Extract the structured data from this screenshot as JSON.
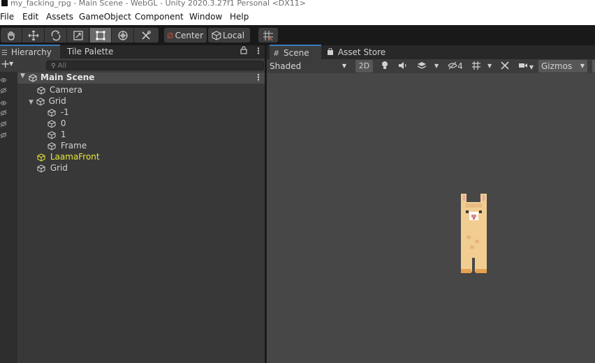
{
  "window": {
    "title": "my_facking_rpg - Main Scene - WebGL - Unity 2020.3.27f1 Personal <DX11>"
  },
  "menu": [
    "File",
    "Edit",
    "Assets",
    "GameObject",
    "Component",
    "Window",
    "Help"
  ],
  "toolbar": {
    "tools": [
      "hand-tool",
      "move-tool",
      "rotate-tool",
      "scale-tool",
      "rect-tool",
      "transform-tool",
      "custom-tool"
    ],
    "active_tool": "rect-tool",
    "pivot_label": "Center",
    "space_label": "Local"
  },
  "hierarchy": {
    "tab_label": "Hierarchy",
    "second_tab_label": "Tile Palette",
    "search_placeholder": "All",
    "scene_name": "Main Scene",
    "items": [
      {
        "label": "Camera"
      },
      {
        "label": "Grid"
      },
      {
        "label": "-1"
      },
      {
        "label": "0"
      },
      {
        "label": "1"
      },
      {
        "label": "Frame"
      },
      {
        "label": "LaamaFront",
        "highlight_color": "#e8e83a"
      },
      {
        "label": "Grid"
      }
    ]
  },
  "scene": {
    "tab_label": "Scene",
    "second_tab_label": "Asset Store",
    "shading_mode": "Shaded",
    "mode_2d_label": "2D",
    "hidden_count": "4",
    "gizmos_label": "Gizmos"
  },
  "colors": {
    "accent": "#3a79bb",
    "selected_object": "#e8e83a",
    "llama_body": "#f2cd92",
    "llama_shade": "#e6b77c",
    "llama_nose": "#d88a8a"
  }
}
